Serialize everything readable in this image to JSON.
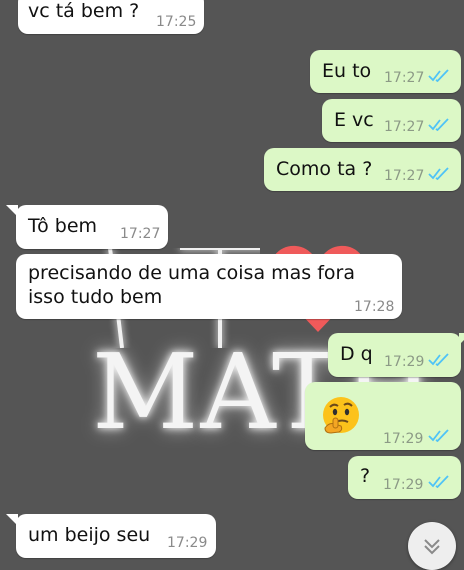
{
  "wallpaper": {
    "text": "MATH"
  },
  "messages": [
    {
      "dir": "in",
      "text": "vc tá bem ?",
      "time": "17:25"
    },
    {
      "dir": "out",
      "text": "Eu to",
      "time": "17:27",
      "status": "read"
    },
    {
      "dir": "out",
      "text": "E vc",
      "time": "17:27",
      "status": "read"
    },
    {
      "dir": "out",
      "text": "Como ta ?",
      "time": "17:27",
      "status": "read"
    },
    {
      "dir": "in",
      "text": "Tô bem",
      "time": "17:27"
    },
    {
      "dir": "in",
      "text": "precisando de uma coisa mas fora isso tudo bem",
      "time": "17:28"
    },
    {
      "dir": "out",
      "text": "D q",
      "time": "17:29",
      "status": "read"
    },
    {
      "dir": "out",
      "emoji": "thinking-face-emoji",
      "time": "17:29",
      "status": "read"
    },
    {
      "dir": "out",
      "text": "?",
      "time": "17:29",
      "status": "read"
    },
    {
      "dir": "in",
      "text": "um beijo seu",
      "time": "17:29"
    }
  ],
  "colors": {
    "background": "#555555",
    "incoming_bubble": "#ffffff",
    "outgoing_bubble": "#dcf8c6",
    "read_tick": "#4fc3f7"
  },
  "icons": {
    "read_status": "double-check-icon",
    "scroll_down": "chevron-double-down-icon"
  }
}
